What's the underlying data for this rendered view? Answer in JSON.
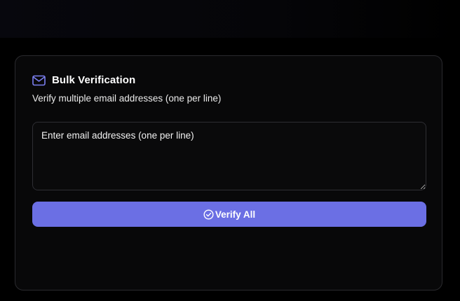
{
  "card": {
    "title": "Bulk Verification",
    "description": "Verify multiple email addresses (one per line)",
    "header_icon": "mail-icon"
  },
  "email_input": {
    "placeholder": "Enter email addresses (one per line)",
    "value": ""
  },
  "verify_button": {
    "label": "Verify All",
    "icon": "check-circle-icon"
  },
  "colors": {
    "accent": "#6b6fe4",
    "icon_accent": "#7b7ff0",
    "background": "#000000",
    "card_background": "#080809",
    "border": "#2a2a2e"
  }
}
